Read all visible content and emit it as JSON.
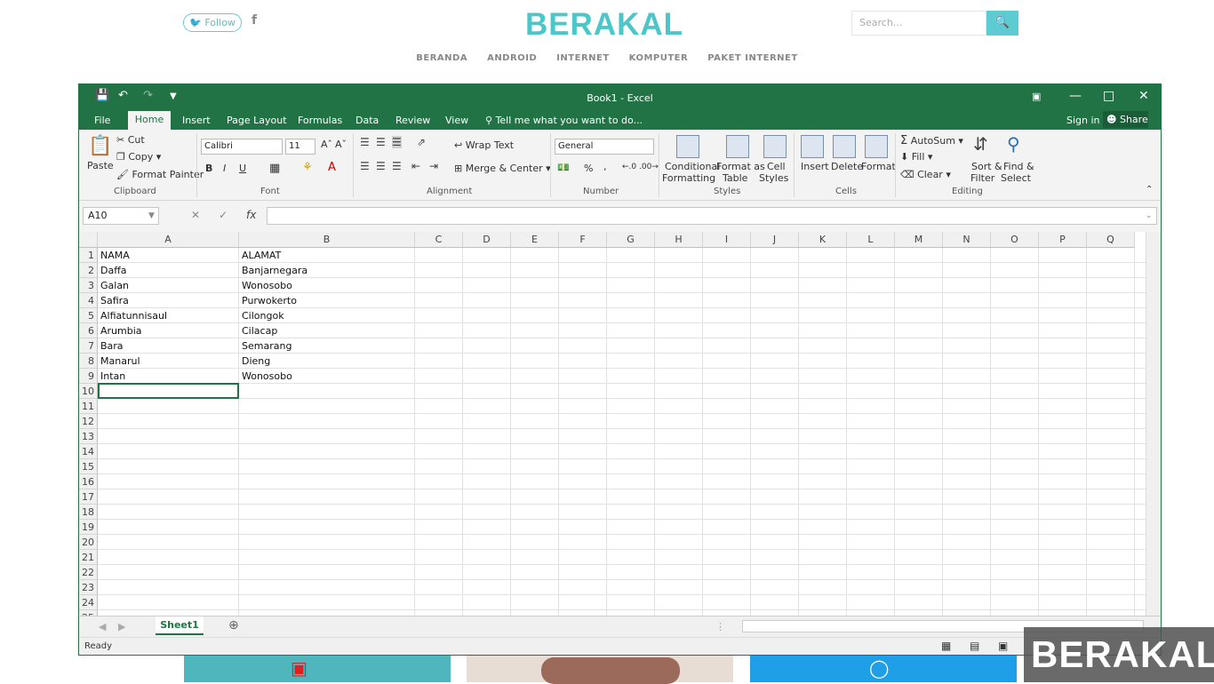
{
  "site": {
    "follow": "Follow",
    "fb": "f",
    "logo": "BERAKAL",
    "search_placeholder": "Search...",
    "nav": [
      "BERANDA",
      "ANDROID",
      "INTERNET",
      "KOMPUTER",
      "PAKET INTERNET"
    ]
  },
  "excel": {
    "title": "Book1 - Excel",
    "tabs": [
      "File",
      "Home",
      "Insert",
      "Page Layout",
      "Formulas",
      "Data",
      "Review",
      "View"
    ],
    "tell_me": "Tell me what you want to do...",
    "sign_in": "Sign in",
    "share": "Share",
    "ribbon": {
      "clipboard": {
        "paste": "Paste",
        "cut": "Cut",
        "copy": "Copy",
        "format_painter": "Format Painter",
        "label": "Clipboard"
      },
      "font": {
        "name": "Calibri",
        "size": "11",
        "bold": "B",
        "italic": "I",
        "underline": "U",
        "label": "Font"
      },
      "alignment": {
        "wrap": "Wrap Text",
        "merge": "Merge & Center",
        "label": "Alignment"
      },
      "number": {
        "format": "General",
        "percent": "%",
        "comma": ",",
        "label": "Number"
      },
      "styles": {
        "conditional_1": "Conditional",
        "conditional_2": "Formatting",
        "table_1": "Format as",
        "table_2": "Table",
        "cell_1": "Cell",
        "cell_2": "Styles",
        "label": "Styles"
      },
      "cells": {
        "insert": "Insert",
        "delete": "Delete",
        "format": "Format",
        "label": "Cells"
      },
      "editing": {
        "autosum": "AutoSum",
        "fill": "Fill",
        "clear": "Clear",
        "sort_1": "Sort &",
        "sort_2": "Filter",
        "find_1": "Find &",
        "find_2": "Select",
        "label": "Editing"
      }
    },
    "namebox": "A10",
    "fx": "fx",
    "columns": [
      {
        "label": "A",
        "w": 159
      },
      {
        "label": "B",
        "w": 198
      },
      {
        "label": "C",
        "w": 54
      },
      {
        "label": "D",
        "w": 54
      },
      {
        "label": "E",
        "w": 54
      },
      {
        "label": "F",
        "w": 54
      },
      {
        "label": "G",
        "w": 54
      },
      {
        "label": "H",
        "w": 54
      },
      {
        "label": "I",
        "w": 54
      },
      {
        "label": "J",
        "w": 54
      },
      {
        "label": "K",
        "w": 54
      },
      {
        "label": "L",
        "w": 54
      },
      {
        "label": "M",
        "w": 54
      },
      {
        "label": "N",
        "w": 54
      },
      {
        "label": "O",
        "w": 54
      },
      {
        "label": "P",
        "w": 54
      },
      {
        "label": "Q",
        "w": 54
      }
    ],
    "rows": [
      [
        "NAMA",
        "ALAMAT"
      ],
      [
        "Daffa",
        "Banjarnegara"
      ],
      [
        "Galan",
        "Wonosobo"
      ],
      [
        "Safira",
        "Purwokerto"
      ],
      [
        "Alfiatunnisaul",
        "Cilongok"
      ],
      [
        "Arumbia",
        "Cilacap"
      ],
      [
        "Bara",
        "Semarang"
      ],
      [
        "Manarul",
        "Dieng"
      ],
      [
        "Intan",
        "Wonosobo"
      ]
    ],
    "row_count": 25,
    "sheet": "Sheet1",
    "status": "Ready"
  },
  "colors": {
    "excel_green": "#217346",
    "brand": "#4cc7c9"
  }
}
